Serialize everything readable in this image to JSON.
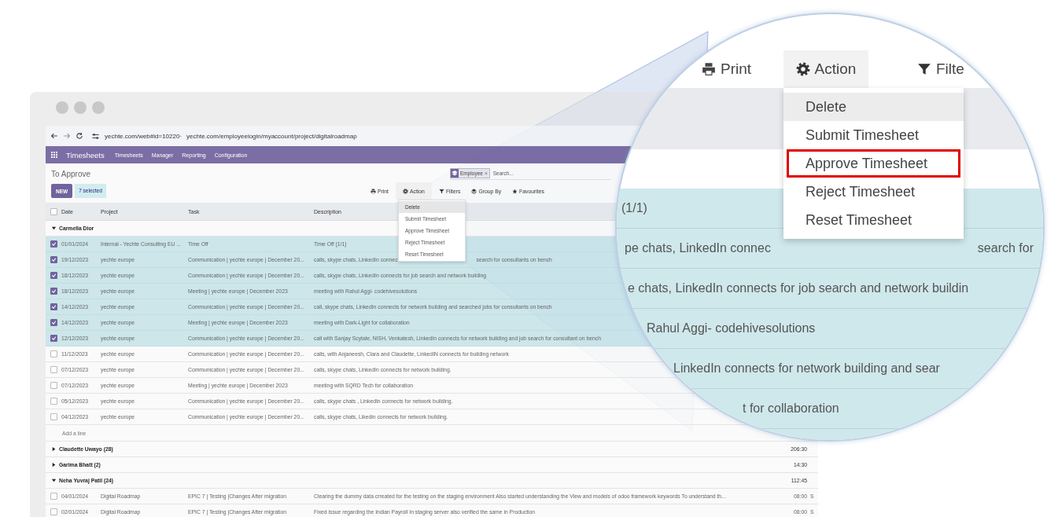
{
  "browser": {
    "url_parts": [
      "yechte.com/web#id=10220·",
      "yechte.com/employeelogin/myaccount/project/digitalroadmap"
    ]
  },
  "navbar": {
    "app": "Timesheets",
    "menu": [
      "Timesheets",
      "Manager",
      "Reporting",
      "Configuration"
    ]
  },
  "control_panel": {
    "title": "To Approve",
    "new_button": "NEW",
    "selection_count": "7 selected",
    "search": {
      "facet": "Employee",
      "facet_remove": "×",
      "placeholder": "Search..."
    },
    "buttons": [
      {
        "label": "Print",
        "selected": false
      },
      {
        "label": "Action",
        "selected": true
      },
      {
        "label": "Filters",
        "selected": false
      },
      {
        "label": "Group By",
        "selected": false
      },
      {
        "label": "Favourites",
        "selected": false
      }
    ]
  },
  "action_menu": {
    "items": [
      {
        "label": "Delete",
        "selected": true
      },
      {
        "label": "Submit Timesheet",
        "selected": false
      },
      {
        "label": "Approve Timesheet",
        "selected": false
      },
      {
        "label": "Reject Timesheet",
        "selected": false
      },
      {
        "label": "Reset Timesheet",
        "selected": false
      }
    ]
  },
  "table": {
    "select_all": {
      "checked": false
    },
    "columns": [
      "Date",
      "Project",
      "Task",
      "Description"
    ],
    "groups": [
      {
        "name": "Carmella Dior",
        "expanded": true,
        "add_line": "Add a line",
        "rows": [
          {
            "checked": true,
            "date": "01/01/2024",
            "project": "Internal - Yechte Consulting EU ...",
            "task": "Time Off",
            "description": "Time Off (1/1)"
          },
          {
            "checked": true,
            "date": "19/12/2023",
            "project": "yechte europe",
            "task": "Communication | yechte europe | December 20...",
            "description": "calls, skype chats, LinkedIn connec",
            "description_tail": "search for consultants on bench"
          },
          {
            "checked": true,
            "date": "18/12/2023",
            "project": "yechte europe",
            "task": "Communication | yechte europe | December 20...",
            "description": "calls, skype chats, LinkedIn connects for job search and network building"
          },
          {
            "checked": true,
            "date": "18/12/2023",
            "project": "yechte europe",
            "task": "Meeting | yechte europe | December 2023",
            "description": "meeting with Rahul Aggi- codehivesolutions"
          },
          {
            "checked": true,
            "date": "14/12/2023",
            "project": "yechte europe",
            "task": "Communication | yechte europe | December 20...",
            "description": "call, skype chats, LinkedIn connects for network building and searched jobs for consultants on bench"
          },
          {
            "checked": true,
            "date": "14/12/2023",
            "project": "yechte europe",
            "task": "Meeting | yechte europe | December 2023",
            "description": "meeting with Dark-Light for collaboration"
          },
          {
            "checked": true,
            "date": "12/12/2023",
            "project": "yechte europe",
            "task": "Communication | yechte europe | December 20...",
            "description": "call with Sanjay Scytale, NISH, Venkatesh, LinkedIn connects for network building and job search for consultant on bench"
          },
          {
            "checked": false,
            "date": "11/12/2023",
            "project": "yechte europe",
            "task": "Communication | yechte europe | December 20...",
            "description": "calls, with Anjaneesh, Clara and Claudette, LinkedIN connects for building network"
          },
          {
            "checked": false,
            "date": "07/12/2023",
            "project": "yechte europe",
            "task": "Communication | yechte europe | December 20...",
            "description": "calls, skype chats, LinkedIn connects for network building."
          },
          {
            "checked": false,
            "date": "07/12/2023",
            "project": "yechte europe",
            "task": "Meeting | yechte europe | December 2023",
            "description": "meeting with SQRD Tech for collaboration"
          },
          {
            "checked": false,
            "date": "05/12/2023",
            "project": "yechte europe",
            "task": "Communication | yechte europe | December 20...",
            "description": "calls, skype chats , LinkedIn connects for network building."
          },
          {
            "checked": false,
            "date": "04/12/2023",
            "project": "yechte europe",
            "task": "Communication | yechte europe | December 20...",
            "description": "calls, skype chats, Likedin connects for network building."
          }
        ]
      },
      {
        "name": "Claudette Uwayo (28)",
        "expanded": false,
        "total": "206:30"
      },
      {
        "name": "Garima Bhatt (2)",
        "expanded": false,
        "total": "14:30"
      },
      {
        "name": "Neha Yuvraj Patil (24)",
        "expanded": true,
        "total": "112:45",
        "rows": [
          {
            "checked": false,
            "date": "04/01/2024",
            "project": "Digital Roadmap",
            "task": "EPIC 7 | Testing |Changes After migration",
            "description": "Clearing the dummy data crreated for the testing on the staging environment Also started understanding the View and models of odoo framework keywords To understand th...",
            "hours": "08:00",
            "column_6": "S"
          },
          {
            "checked": false,
            "date": "02/01/2024",
            "project": "Digital Roadmap",
            "task": "EPIC 7 | Testing |Changes After migration",
            "description": "Fixed issue regarding the Indian Payroll In staging server also verified the same in Production",
            "hours": "08:00",
            "column_6": "S"
          }
        ]
      }
    ]
  },
  "magnifier": {
    "toolbar": [
      {
        "label": "Print",
        "selected": false
      },
      {
        "label": "Action",
        "selected": true
      },
      {
        "label": "Filte",
        "selected": false
      }
    ],
    "menu": [
      {
        "label": "Delete",
        "selected": true,
        "outlined": false
      },
      {
        "label": "Submit Timesheet",
        "selected": false,
        "outlined": false
      },
      {
        "label": "Approve Timesheet",
        "selected": false,
        "outlined": true
      },
      {
        "label": "Reject Timesheet",
        "selected": false,
        "outlined": false
      },
      {
        "label": "Reset Timesheet",
        "selected": false,
        "outlined": false
      }
    ],
    "rows": [
      {
        "text": "(1/1)"
      },
      {
        "text": "pe chats, LinkedIn connec",
        "tail": "search for"
      },
      {
        "text": "e chats, LinkedIn connects for job search and network buildin"
      },
      {
        "text": "Rahul Aggi- codehivesolutions"
      },
      {
        "text": "LinkedIn connects for network building and sear"
      },
      {
        "text": "t for collaboration"
      }
    ]
  }
}
